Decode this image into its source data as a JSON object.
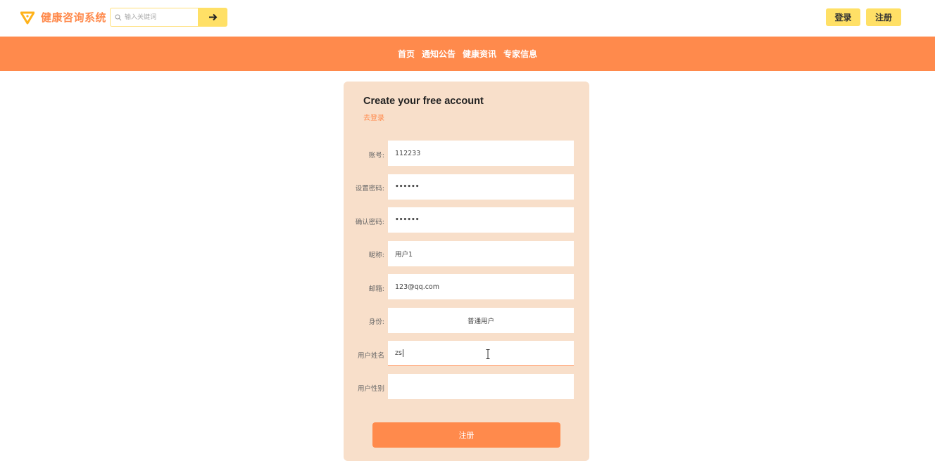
{
  "header": {
    "app_title": "健康咨询系统",
    "search_placeholder": "输入关键词",
    "search_value": "",
    "login_label": "登录",
    "register_label": "注册"
  },
  "nav": {
    "items": [
      "首页",
      "通知公告",
      "健康资讯",
      "专家信息"
    ]
  },
  "form": {
    "title": "Create your free account",
    "login_link": "去登录",
    "fields": [
      {
        "label": "账号:",
        "value": "112233"
      },
      {
        "label": "设置密码:",
        "value": "••••••"
      },
      {
        "label": "确认密码:",
        "value": "••••••"
      },
      {
        "label": "昵称:",
        "value": "用户1"
      },
      {
        "label": "邮箱:",
        "value": "123@qq.com"
      },
      {
        "label": "身份:",
        "value": "普通用户"
      },
      {
        "label": "用户姓名",
        "value": "zs"
      },
      {
        "label": "用户性别",
        "value": ""
      }
    ],
    "submit_label": "注册"
  },
  "colors": {
    "accent": "#ff8a4c",
    "button_yellow": "#ffe066",
    "card_bg": "#f8dfca"
  }
}
